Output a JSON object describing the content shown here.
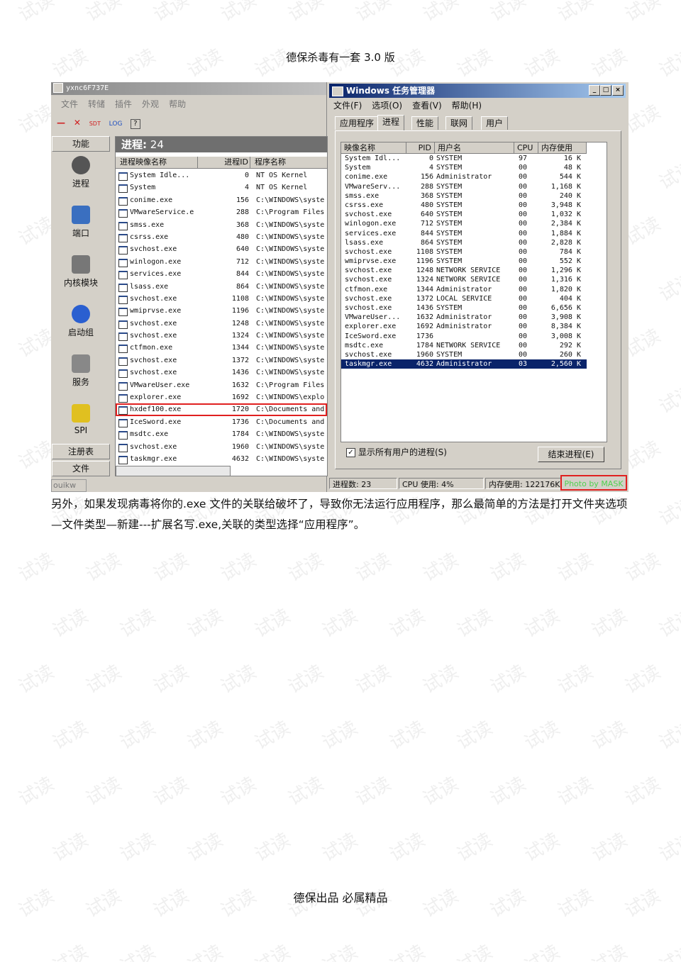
{
  "header": {
    "title": "德保杀毒有一套  3.0 版"
  },
  "footer": {
    "text": "德保出品  必属精品"
  },
  "watermark": {
    "text": "试读"
  },
  "body_text": "另外，如果发现病毒将你的.exe 文件的关联给破坏了，导致你无法运行应用程序，那么最简单的方法是打开文件夹选项—文件类型—新建---扩展名写.exe,关联的类型选择“应用程序”。",
  "screenshot": {
    "left_window": {
      "title": "yxnc6F737E",
      "menu": [
        "文件",
        "转储",
        "插件",
        "外观",
        "帮助"
      ],
      "toolbar": {
        "minus": "—",
        "close": "✕",
        "sdt": "SDT",
        "log": "LOG",
        "help": "?"
      },
      "side_header": "功能",
      "side_items": [
        "进程",
        "端口",
        "内核模块",
        "启动组",
        "服务",
        "SPI"
      ],
      "side_buttons": [
        "注册表",
        "文件"
      ],
      "status": "ouikw",
      "process_label": "进程:",
      "process_count": "24",
      "columns": [
        "进程映像名称",
        "进程ID",
        "程序名称"
      ],
      "rows": [
        {
          "name": "System Idle...",
          "pid": "0",
          "path": "NT OS Kernel"
        },
        {
          "name": "System",
          "pid": "4",
          "path": "NT OS Kernel"
        },
        {
          "name": "conime.exe",
          "pid": "156",
          "path": "C:\\WINDOWS\\syste"
        },
        {
          "name": "VMwareService.e",
          "pid": "288",
          "path": "C:\\Program Files"
        },
        {
          "name": "smss.exe",
          "pid": "368",
          "path": "C:\\WINDOWS\\syste"
        },
        {
          "name": "csrss.exe",
          "pid": "480",
          "path": "C:\\WINDOWS\\syste"
        },
        {
          "name": "svchost.exe",
          "pid": "640",
          "path": "C:\\WINDOWS\\syste"
        },
        {
          "name": "winlogon.exe",
          "pid": "712",
          "path": "C:\\WINDOWS\\syste"
        },
        {
          "name": "services.exe",
          "pid": "844",
          "path": "C:\\WINDOWS\\syste"
        },
        {
          "name": "lsass.exe",
          "pid": "864",
          "path": "C:\\WINDOWS\\syste"
        },
        {
          "name": "svchost.exe",
          "pid": "1108",
          "path": "C:\\WINDOWS\\syste"
        },
        {
          "name": "wmiprvse.exe",
          "pid": "1196",
          "path": "C:\\WINDOWS\\syste"
        },
        {
          "name": "svchost.exe",
          "pid": "1248",
          "path": "C:\\WINDOWS\\syste"
        },
        {
          "name": "svchost.exe",
          "pid": "1324",
          "path": "C:\\WINDOWS\\syste"
        },
        {
          "name": "ctfmon.exe",
          "pid": "1344",
          "path": "C:\\WINDOWS\\syste"
        },
        {
          "name": "svchost.exe",
          "pid": "1372",
          "path": "C:\\WINDOWS\\syste"
        },
        {
          "name": "svchost.exe",
          "pid": "1436",
          "path": "C:\\WINDOWS\\syste"
        },
        {
          "name": "VMwareUser.exe",
          "pid": "1632",
          "path": "C:\\Program Files"
        },
        {
          "name": "explorer.exe",
          "pid": "1692",
          "path": "C:\\WINDOWS\\explo"
        },
        {
          "name": "hxdef100.exe",
          "pid": "1720",
          "path": "C:\\Documents and",
          "highlight": true
        },
        {
          "name": "IceSword.exe",
          "pid": "1736",
          "path": "C:\\Documents and"
        },
        {
          "name": "msdtc.exe",
          "pid": "1784",
          "path": "C:\\WINDOWS\\syste"
        },
        {
          "name": "svchost.exe",
          "pid": "1960",
          "path": "C:\\WINDOWS\\syste"
        },
        {
          "name": "taskmgr.exe",
          "pid": "4632",
          "path": "C:\\WINDOWS\\syste"
        }
      ]
    },
    "right_window": {
      "title": "Windows 任务管理器",
      "menu": [
        "文件(F)",
        "选项(O)",
        "查看(V)",
        "帮助(H)"
      ],
      "tabs": [
        "应用程序",
        "进程",
        "性能",
        "联网",
        "用户"
      ],
      "active_tab": "进程",
      "columns": [
        "映像名称",
        "PID",
        "用户名",
        "CPU",
        "内存使用"
      ],
      "rows": [
        [
          "System Idl...",
          "0",
          "SYSTEM",
          "97",
          "16 K"
        ],
        [
          "System",
          "4",
          "SYSTEM",
          "00",
          "48 K"
        ],
        [
          "conime.exe",
          "156",
          "Administrator",
          "00",
          "544 K"
        ],
        [
          "VMwareServ...",
          "288",
          "SYSTEM",
          "00",
          "1,168 K"
        ],
        [
          "smss.exe",
          "368",
          "SYSTEM",
          "00",
          "240 K"
        ],
        [
          "csrss.exe",
          "480",
          "SYSTEM",
          "00",
          "3,948 K"
        ],
        [
          "svchost.exe",
          "640",
          "SYSTEM",
          "00",
          "1,032 K"
        ],
        [
          "winlogon.exe",
          "712",
          "SYSTEM",
          "00",
          "2,384 K"
        ],
        [
          "services.exe",
          "844",
          "SYSTEM",
          "00",
          "1,884 K"
        ],
        [
          "lsass.exe",
          "864",
          "SYSTEM",
          "00",
          "2,828 K"
        ],
        [
          "svchost.exe",
          "1108",
          "SYSTEM",
          "00",
          "784 K"
        ],
        [
          "wmiprvse.exe",
          "1196",
          "SYSTEM",
          "00",
          "552 K"
        ],
        [
          "svchost.exe",
          "1248",
          "NETWORK SERVICE",
          "00",
          "1,296 K"
        ],
        [
          "svchost.exe",
          "1324",
          "NETWORK SERVICE",
          "00",
          "1,316 K"
        ],
        [
          "ctfmon.exe",
          "1344",
          "Administrator",
          "00",
          "1,820 K"
        ],
        [
          "svchost.exe",
          "1372",
          "LOCAL SERVICE",
          "00",
          "404 K"
        ],
        [
          "svchost.exe",
          "1436",
          "SYSTEM",
          "00",
          "6,656 K"
        ],
        [
          "VMwareUser...",
          "1632",
          "Administrator",
          "00",
          "3,908 K"
        ],
        [
          "explorer.exe",
          "1692",
          "Administrator",
          "00",
          "8,384 K"
        ],
        [
          "IceSword.exe",
          "1736",
          "",
          "00",
          "3,008 K"
        ],
        [
          "msdtc.exe",
          "1784",
          "NETWORK SERVICE",
          "00",
          "292 K"
        ],
        [
          "svchost.exe",
          "1960",
          "SYSTEM",
          "00",
          "260 K"
        ],
        [
          "taskmgr.exe",
          "4632",
          "Administrator",
          "03",
          "2,560 K"
        ]
      ],
      "selected_row": 22,
      "show_all_label": "显示所有用户的进程(S)",
      "end_process_button": "结束进程(E)",
      "status": {
        "processes": "进程数: 23",
        "cpu": "CPU 使用: 4%",
        "memory": "内存使用: 122176K"
      },
      "credit": "Photo by MASK"
    }
  }
}
